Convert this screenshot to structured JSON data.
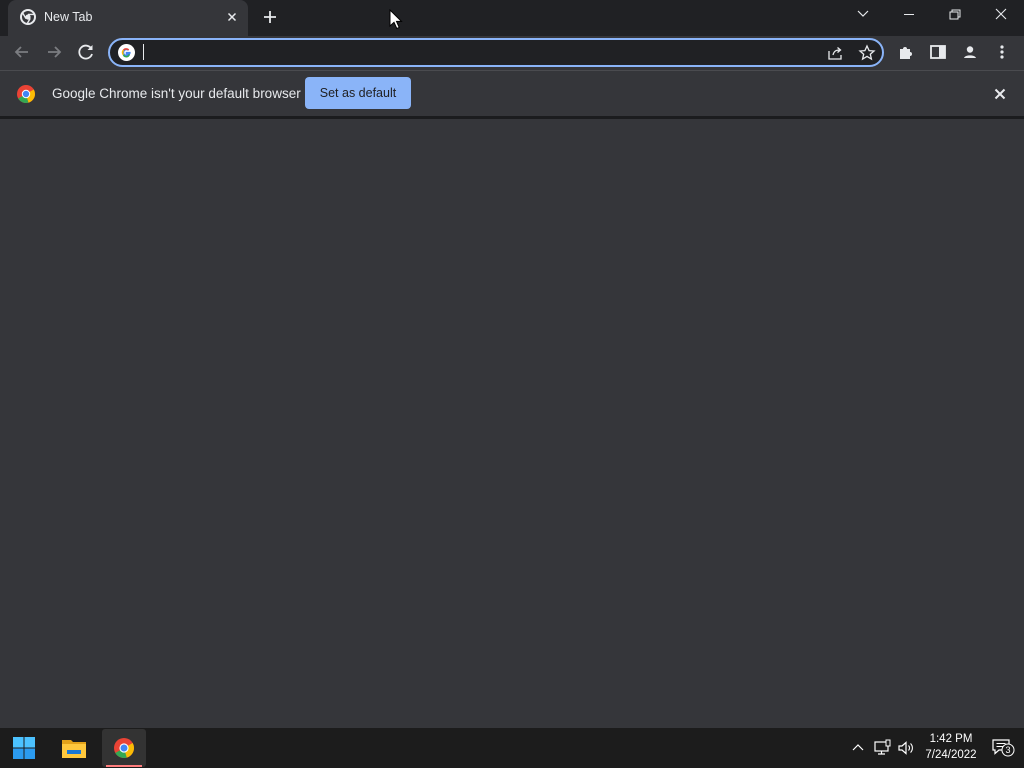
{
  "browser": {
    "tab": {
      "title": "New Tab"
    },
    "omnibox": {
      "value": "",
      "placeholder": ""
    },
    "infobar": {
      "message": "Google Chrome isn't your default browser",
      "button_label": "Set as default"
    },
    "icons": {
      "tab_favicon": "chrome-icon",
      "tab_close": "close-icon",
      "new_tab": "plus-icon",
      "tab_search": "chevron-down-icon",
      "minimize": "minimize-icon",
      "restore": "restore-icon",
      "close": "close-icon",
      "back": "arrow-left-icon",
      "forward": "arrow-right-icon",
      "reload": "reload-icon",
      "site_info": "google-g-icon",
      "share": "share-icon",
      "bookmark": "star-icon",
      "extensions": "puzzle-icon",
      "side_panel": "side-panel-icon",
      "profile": "person-icon",
      "menu": "kebab-menu-icon"
    },
    "colors": {
      "accent": "#8ab4f8",
      "frame": "#202124",
      "toolbar": "#35363a",
      "text": "#e8eaed"
    }
  },
  "taskbar": {
    "apps": [
      "start-icon",
      "file-explorer-icon",
      "chrome-icon"
    ],
    "active_app": "chrome",
    "tray_icons": [
      "chevron-up-icon",
      "network-icon",
      "volume-icon"
    ],
    "clock": {
      "time": "1:42 PM",
      "date": "7/24/2022"
    },
    "notifications": {
      "count": "3"
    }
  }
}
